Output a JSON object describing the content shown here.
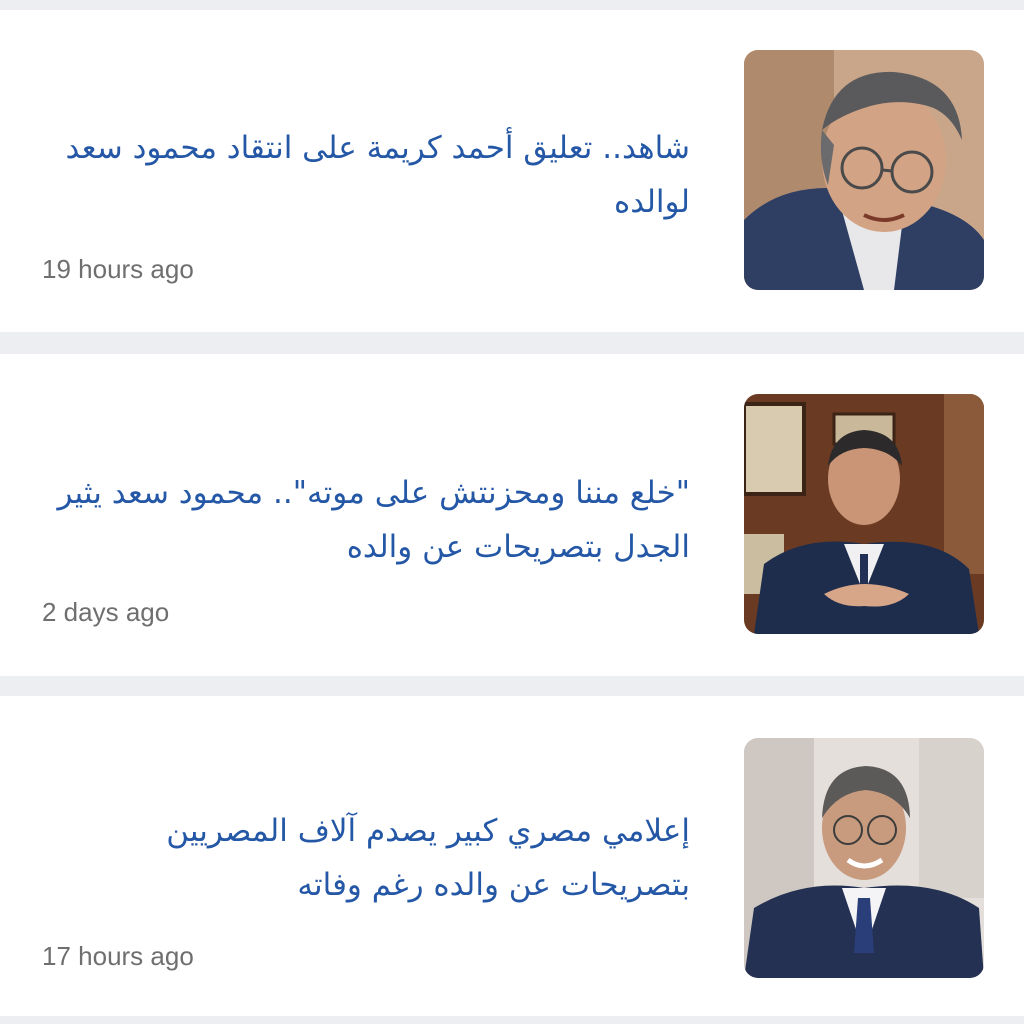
{
  "articles": [
    {
      "headline": "شاهد.. تعليق أحمد كريمة على انتقاد محمود سعد لوالده",
      "time": "19 hours ago"
    },
    {
      "headline": "\"خلع مننا ومحزنتش على موته\".. محمود سعد يثير الجدل بتصريحات عن والده",
      "time": "2 days ago"
    },
    {
      "headline": "إعلامي مصري كبير يصدم آلاف المصريين بتصريحات عن والده رغم وفاته",
      "time": "17 hours ago"
    }
  ],
  "colors": {
    "headline": "#2457a6",
    "timestamp": "#6f6f6f",
    "background": "#eceef1",
    "card": "#ffffff"
  }
}
